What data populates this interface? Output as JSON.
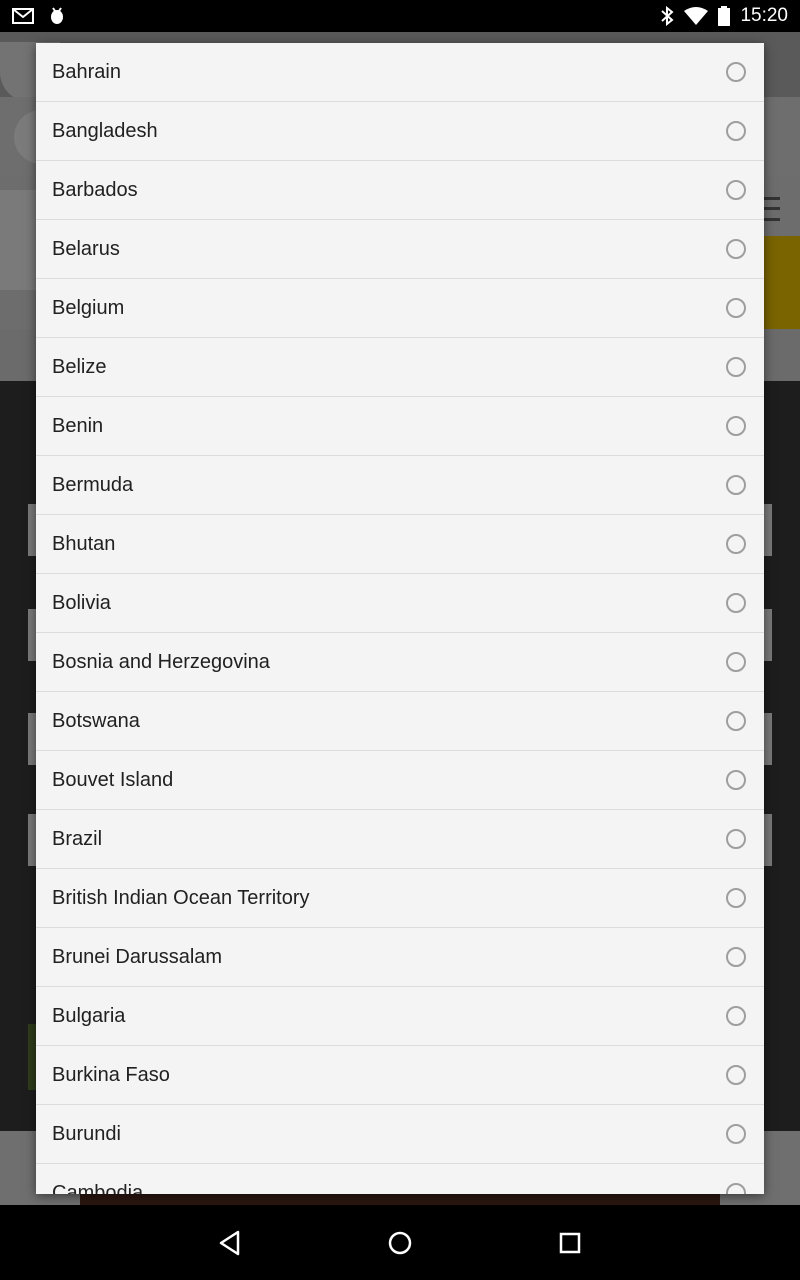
{
  "status_bar": {
    "time": "15:20",
    "left_icons": [
      "gmail-icon",
      "android-debug-icon"
    ],
    "right_icons": [
      "bluetooth-icon",
      "wifi-icon",
      "battery-icon"
    ]
  },
  "dialog": {
    "items": [
      {
        "label": "Bahrain",
        "selected": false
      },
      {
        "label": "Bangladesh",
        "selected": false
      },
      {
        "label": "Barbados",
        "selected": false
      },
      {
        "label": "Belarus",
        "selected": false
      },
      {
        "label": "Belgium",
        "selected": false
      },
      {
        "label": "Belize",
        "selected": false
      },
      {
        "label": "Benin",
        "selected": false
      },
      {
        "label": "Bermuda",
        "selected": false
      },
      {
        "label": "Bhutan",
        "selected": false
      },
      {
        "label": "Bolivia",
        "selected": false
      },
      {
        "label": "Bosnia and Herzegovina",
        "selected": false
      },
      {
        "label": "Botswana",
        "selected": false
      },
      {
        "label": "Bouvet Island",
        "selected": false
      },
      {
        "label": "Brazil",
        "selected": false
      },
      {
        "label": "British Indian Ocean Territory",
        "selected": false
      },
      {
        "label": "Brunei Darussalam",
        "selected": false
      },
      {
        "label": "Bulgaria",
        "selected": false
      },
      {
        "label": "Burkina Faso",
        "selected": false
      },
      {
        "label": "Burundi",
        "selected": false
      },
      {
        "label": "Cambodia",
        "selected": false
      }
    ]
  },
  "nav_bar": {
    "buttons": [
      "back-icon",
      "home-icon",
      "recents-icon"
    ]
  }
}
